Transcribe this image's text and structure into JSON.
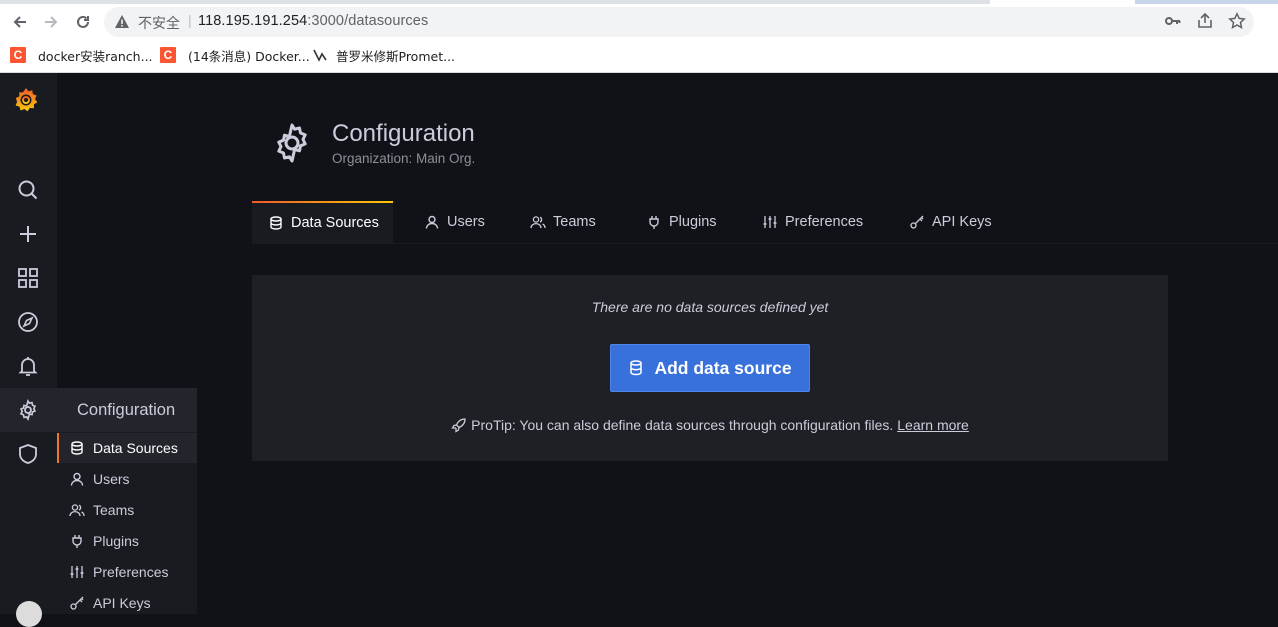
{
  "browser": {
    "not_secure_label": "不安全",
    "separator": "|",
    "url_host": "118.195.191.254",
    "url_rest": ":3000/datasources",
    "bookmarks": [
      {
        "label": "docker安装ranch..."
      },
      {
        "label": "(14条消息) Docker..."
      },
      {
        "label": "普罗米修斯Promet..."
      }
    ],
    "bookmark_logo_letter": "C"
  },
  "sidemenu": {
    "icons": [
      "grafana-logo-icon",
      "search-icon",
      "plus-icon",
      "dashboards-icon",
      "explore-icon",
      "alerting-icon",
      "gear-icon",
      "shield-icon",
      "avatar"
    ]
  },
  "flyout": {
    "title": "Configuration",
    "items": [
      {
        "label": "Data Sources",
        "icon": "database-icon",
        "active": true
      },
      {
        "label": "Users",
        "icon": "user-icon"
      },
      {
        "label": "Teams",
        "icon": "users-icon"
      },
      {
        "label": "Plugins",
        "icon": "plug-icon"
      },
      {
        "label": "Preferences",
        "icon": "sliders-icon"
      },
      {
        "label": "API Keys",
        "icon": "key-icon"
      }
    ]
  },
  "header": {
    "title": "Configuration",
    "subtitle": "Organization: Main Org."
  },
  "tabs": [
    {
      "label": "Data Sources",
      "icon": "database-icon",
      "active": true
    },
    {
      "label": "Users",
      "icon": "user-icon"
    },
    {
      "label": "Teams",
      "icon": "users-icon"
    },
    {
      "label": "Plugins",
      "icon": "plug-icon"
    },
    {
      "label": "Preferences",
      "icon": "sliders-icon"
    },
    {
      "label": "API Keys",
      "icon": "key-icon"
    }
  ],
  "empty": {
    "message": "There are no data sources defined yet",
    "button_label": "Add data source",
    "protip": "ProTip: You can also define data sources through configuration files.",
    "learn_more": "Learn more"
  },
  "colors": {
    "accent": "#3871dc",
    "active_tab_gradient_start": "#f05a28",
    "active_tab_gradient_end": "#fbca0a",
    "background": "#111217",
    "panel": "#181b1f"
  }
}
